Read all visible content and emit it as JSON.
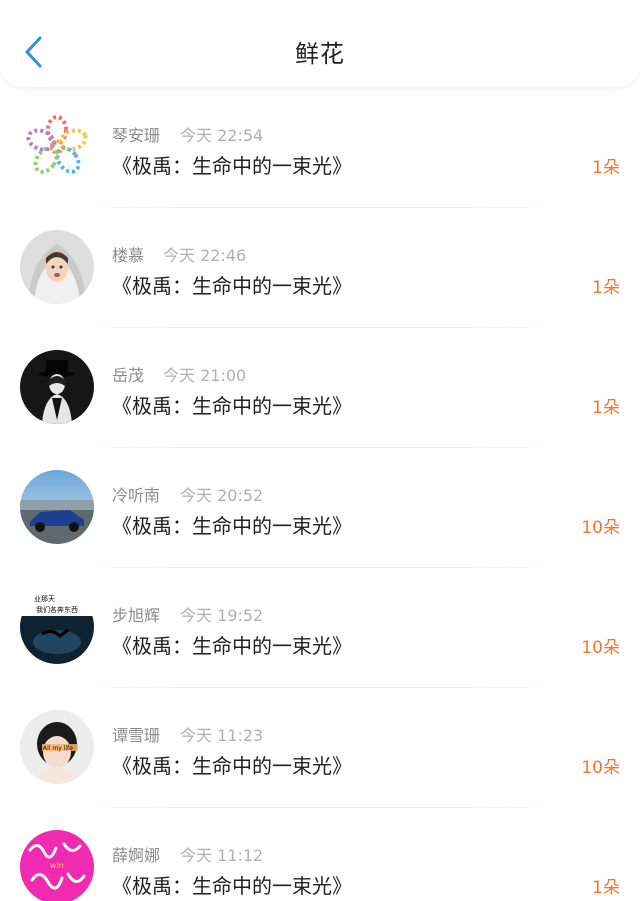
{
  "header": {
    "title": "鲜花",
    "back_icon": "chevron-left-icon",
    "accent_color": "#2b8ff0"
  },
  "count_color": "#f0772f",
  "items": [
    {
      "name": "琴安珊",
      "time": "今天 22:54",
      "book": "《极禹：生命中的一束光》",
      "count": "1朵",
      "avatar": "flower-ring-avatar"
    },
    {
      "name": "楼慕",
      "time": "今天 22:46",
      "book": "《极禹：生命中的一束光》",
      "count": "1朵",
      "avatar": "hooded-girl-avatar"
    },
    {
      "name": "岳茂",
      "time": "今天 21:00",
      "book": "《极禹：生命中的一束光》",
      "count": "1朵",
      "avatar": "top-hat-figure-avatar"
    },
    {
      "name": "冷听南",
      "time": "今天 20:52",
      "book": "《极禹：生命中的一束光》",
      "count": "10朵",
      "avatar": "blue-car-avatar"
    },
    {
      "name": "步旭辉",
      "time": "今天 19:52",
      "book": "《极禹：生命中的一束光》",
      "count": "10朵",
      "avatar": "night-text-avatar",
      "avatar_text_1": "业那天",
      "avatar_text_2": "我们各奔东西"
    },
    {
      "name": "谭雪珊",
      "time": "今天 11:23",
      "book": "《极禹：生命中的一束光》",
      "count": "10朵",
      "avatar": "girl-face-avatar",
      "avatar_text": "All my life"
    },
    {
      "name": "薛婀娜",
      "time": "今天 11:12",
      "book": "《极禹：生命中的一束光》",
      "count": "1朵",
      "avatar": "pink-handwriting-avatar",
      "avatar_text": "win"
    }
  ]
}
